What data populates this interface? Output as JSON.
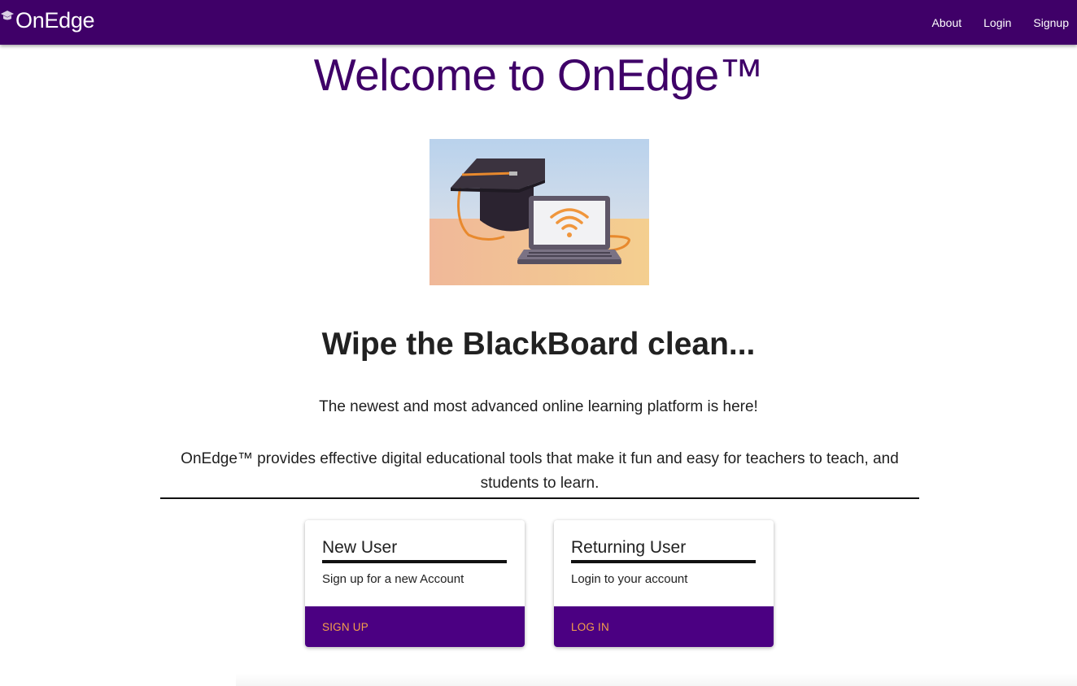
{
  "nav": {
    "brand": "OnEdge",
    "brand_icon": "graduation-cap-icon",
    "links": [
      {
        "label": "About"
      },
      {
        "label": "Login"
      },
      {
        "label": "Signup"
      }
    ]
  },
  "hero": {
    "title": "Welcome to OnEdge™",
    "image": "graduation-cap-laptop-wifi-illustration",
    "subtitle": "Wipe the BlackBoard clean...",
    "tagline": "The newest and most advanced online learning platform is here!",
    "description": "OnEdge™ provides effective digital educational tools that make it fun and easy for teachers to teach, and students to learn."
  },
  "cards": {
    "new_user": {
      "title": "New User",
      "text": "Sign up for a new Account",
      "button": "SIGN UP"
    },
    "returning_user": {
      "title": "Returning User",
      "text": "Login to your account",
      "button": "LOG IN"
    }
  },
  "colors": {
    "primary_purple": "#3f0068",
    "button_purple": "#4b0082",
    "button_text": "#f5a04a"
  }
}
